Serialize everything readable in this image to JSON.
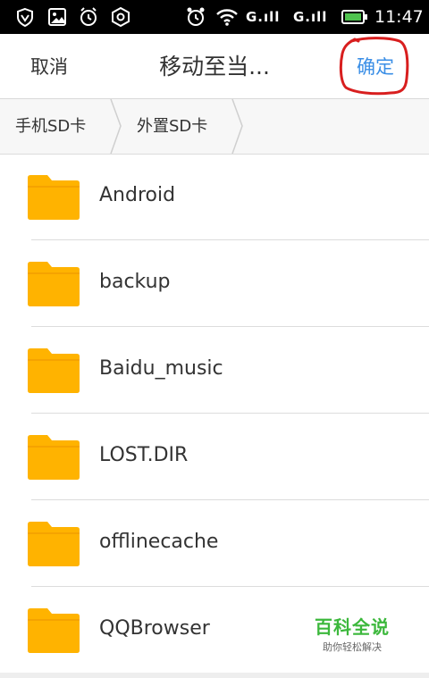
{
  "status_bar": {
    "time": "11:47",
    "signal_1": "G.ıll",
    "signal_2": "G.ıll",
    "icons": [
      "shield-v-icon",
      "image-icon",
      "alarm-icon",
      "settings-hex-icon",
      "alarm-clock-icon",
      "wifi-icon",
      "battery-icon"
    ]
  },
  "title_bar": {
    "cancel_label": "取消",
    "title": "移动至当...",
    "confirm_label": "确定"
  },
  "breadcrumb": {
    "items": [
      "手机SD卡",
      "外置SD卡"
    ]
  },
  "folders": [
    {
      "name": "Android"
    },
    {
      "name": "backup"
    },
    {
      "name": "Baidu_music"
    },
    {
      "name": "LOST.DIR"
    },
    {
      "name": "offlinecache"
    },
    {
      "name": "QQBrowser"
    }
  ],
  "watermark": {
    "title": "百科全说",
    "subtitle": "助你轻松解决"
  },
  "colors": {
    "accent": "#3a8ee6",
    "folder": "#ffb300",
    "annotation": "#d81e1e",
    "watermark": "#3cb83c"
  }
}
